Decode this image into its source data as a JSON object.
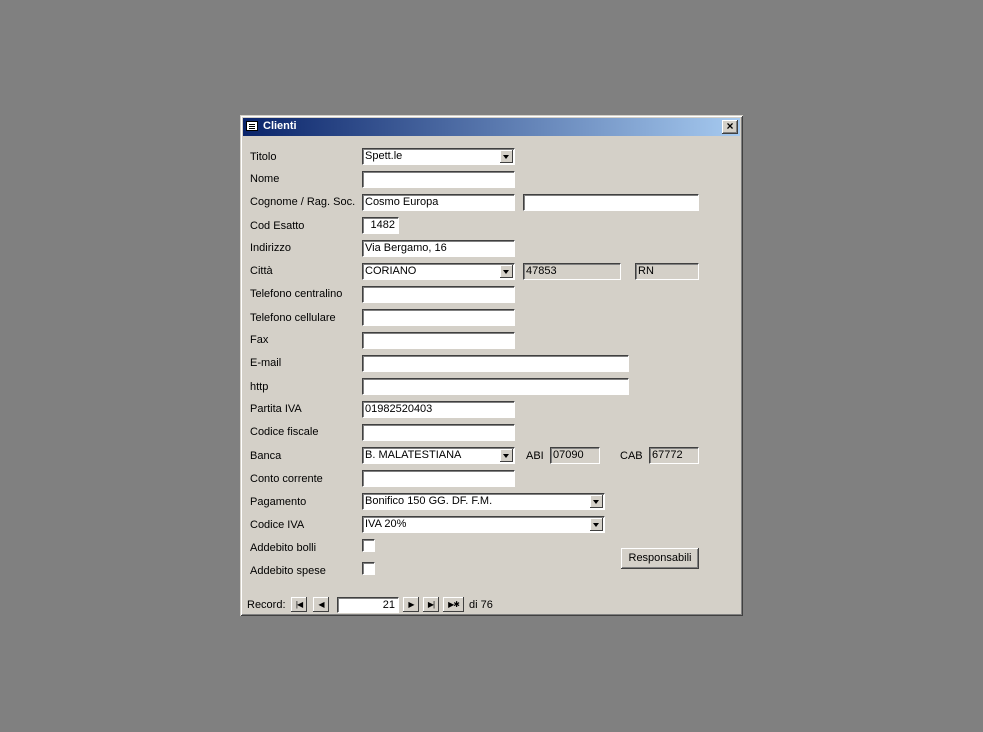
{
  "window": {
    "title": "Clienti",
    "close_label": "×"
  },
  "form": {
    "titolo": {
      "label": "Titolo",
      "value": "Spett.le"
    },
    "nome": {
      "label": "Nome",
      "value": ""
    },
    "cognome": {
      "label": "Cognome / Rag. Soc.",
      "value": "Cosmo Europa",
      "value2": ""
    },
    "cod_esatto": {
      "label": "Cod Esatto",
      "value": "1482"
    },
    "indirizzo": {
      "label": "Indirizzo",
      "value": "Via Bergamo, 16"
    },
    "citta": {
      "label": "Città",
      "value": "CORIANO",
      "cap": "47853",
      "prov": "RN"
    },
    "tel_centralino": {
      "label": "Telefono centralino",
      "value": ""
    },
    "tel_cellulare": {
      "label": "Telefono cellulare",
      "value": ""
    },
    "fax": {
      "label": "Fax",
      "value": ""
    },
    "email": {
      "label": "E-mail",
      "value": ""
    },
    "http": {
      "label": "http",
      "value": ""
    },
    "partita_iva": {
      "label": "Partita IVA",
      "value": "01982520403"
    },
    "codice_fiscale": {
      "label": "Codice fiscale",
      "value": ""
    },
    "banca": {
      "label": "Banca",
      "value": "B. MALATESTIANA",
      "abi_label": "ABI",
      "abi": "07090",
      "cab_label": "CAB",
      "cab": "67772"
    },
    "conto_corrente": {
      "label": "Conto corrente",
      "value": ""
    },
    "pagamento": {
      "label": "Pagamento",
      "value": "Bonifico 150 GG. DF. F.M."
    },
    "codice_iva": {
      "label": "Codice IVA",
      "value": "IVA 20%"
    },
    "addebito_bolli": {
      "label": "Addebito bolli",
      "checked": false
    },
    "addebito_spese": {
      "label": "Addebito spese",
      "checked": false
    },
    "responsabili_label": "Responsabili"
  },
  "navigation": {
    "record_label": "Record:",
    "current": "21",
    "of_text": "di 76",
    "first_icon": "first-record-icon",
    "prev_icon": "previous-record-icon",
    "next_icon": "next-record-icon",
    "last_icon": "last-record-icon",
    "new_icon": "new-record-icon"
  }
}
